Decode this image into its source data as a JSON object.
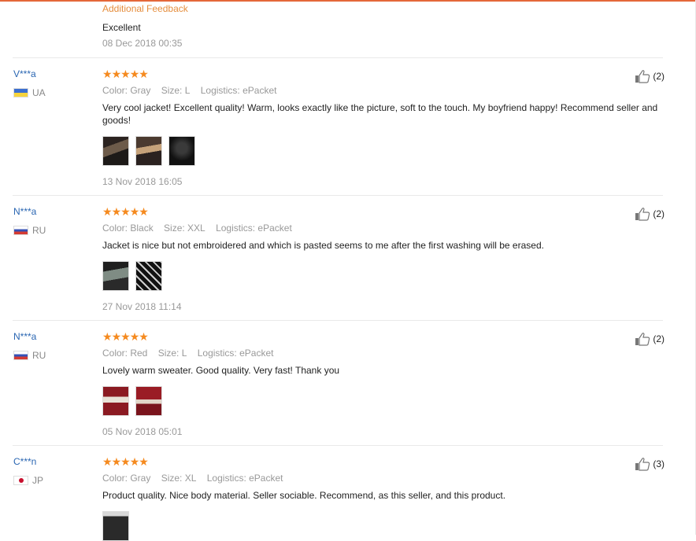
{
  "top": {
    "additional_feedback_label": "Additional Feedback",
    "feedback_text": "Excellent",
    "date": "08 Dec 2018 00:35"
  },
  "reviews": [
    {
      "user": "V***a",
      "country": "UA",
      "rating": 5,
      "meta": {
        "color": "Color: Gray",
        "size": "Size: L",
        "logistics": "Logistics: ePacket"
      },
      "text": "Very cool jacket! Excellent quality! Warm, looks exactly like the picture, soft to the touch. My boyfriend happy! Recommend seller and goods!",
      "photos": 3,
      "date": "13 Nov 2018 16:05",
      "likes": "(2)"
    },
    {
      "user": "N***a",
      "country": "RU",
      "rating": 5,
      "meta": {
        "color": "Color: Black",
        "size": "Size: XXL",
        "logistics": "Logistics: ePacket"
      },
      "text": "Jacket is nice but not embroidered and which is pasted seems to me after the first washing will be erased.",
      "photos": 2,
      "date": "27 Nov 2018 11:14",
      "likes": "(2)"
    },
    {
      "user": "N***a",
      "country": "RU",
      "rating": 5,
      "meta": {
        "color": "Color: Red",
        "size": "Size: L",
        "logistics": "Logistics: ePacket"
      },
      "text": "Lovely warm sweater. Good quality. Very fast! Thank you",
      "photos": 2,
      "date": "05 Nov 2018 05:01",
      "likes": "(2)"
    },
    {
      "user": "C***n",
      "country": "JP",
      "rating": 5,
      "meta": {
        "color": "Color: Gray",
        "size": "Size: XL",
        "logistics": "Logistics: ePacket"
      },
      "text": "Product quality. Nice body material. Seller sociable. Recommend, as this seller, and this product.",
      "photos": 1,
      "date": "",
      "likes": "(3)"
    }
  ],
  "colors": {
    "accent": "#e4673a",
    "star": "#f58a1f",
    "username": "#2a66b2",
    "muted": "#999999"
  },
  "icons": {
    "like": "thumbs-up-icon",
    "star": "star-icon"
  }
}
